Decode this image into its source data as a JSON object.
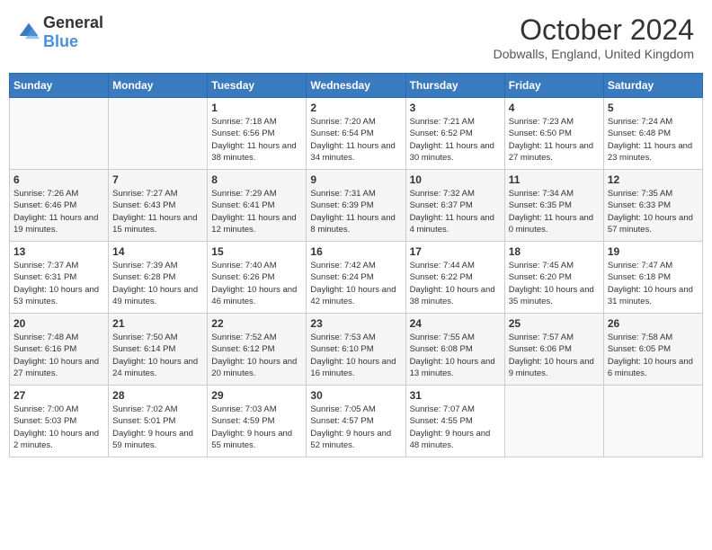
{
  "header": {
    "logo_general": "General",
    "logo_blue": "Blue",
    "month_title": "October 2024",
    "location": "Dobwalls, England, United Kingdom"
  },
  "days_of_week": [
    "Sunday",
    "Monday",
    "Tuesday",
    "Wednesday",
    "Thursday",
    "Friday",
    "Saturday"
  ],
  "weeks": [
    [
      {
        "day": "",
        "info": ""
      },
      {
        "day": "",
        "info": ""
      },
      {
        "day": "1",
        "info": "Sunrise: 7:18 AM\nSunset: 6:56 PM\nDaylight: 11 hours and 38 minutes."
      },
      {
        "day": "2",
        "info": "Sunrise: 7:20 AM\nSunset: 6:54 PM\nDaylight: 11 hours and 34 minutes."
      },
      {
        "day": "3",
        "info": "Sunrise: 7:21 AM\nSunset: 6:52 PM\nDaylight: 11 hours and 30 minutes."
      },
      {
        "day": "4",
        "info": "Sunrise: 7:23 AM\nSunset: 6:50 PM\nDaylight: 11 hours and 27 minutes."
      },
      {
        "day": "5",
        "info": "Sunrise: 7:24 AM\nSunset: 6:48 PM\nDaylight: 11 hours and 23 minutes."
      }
    ],
    [
      {
        "day": "6",
        "info": "Sunrise: 7:26 AM\nSunset: 6:46 PM\nDaylight: 11 hours and 19 minutes."
      },
      {
        "day": "7",
        "info": "Sunrise: 7:27 AM\nSunset: 6:43 PM\nDaylight: 11 hours and 15 minutes."
      },
      {
        "day": "8",
        "info": "Sunrise: 7:29 AM\nSunset: 6:41 PM\nDaylight: 11 hours and 12 minutes."
      },
      {
        "day": "9",
        "info": "Sunrise: 7:31 AM\nSunset: 6:39 PM\nDaylight: 11 hours and 8 minutes."
      },
      {
        "day": "10",
        "info": "Sunrise: 7:32 AM\nSunset: 6:37 PM\nDaylight: 11 hours and 4 minutes."
      },
      {
        "day": "11",
        "info": "Sunrise: 7:34 AM\nSunset: 6:35 PM\nDaylight: 11 hours and 0 minutes."
      },
      {
        "day": "12",
        "info": "Sunrise: 7:35 AM\nSunset: 6:33 PM\nDaylight: 10 hours and 57 minutes."
      }
    ],
    [
      {
        "day": "13",
        "info": "Sunrise: 7:37 AM\nSunset: 6:31 PM\nDaylight: 10 hours and 53 minutes."
      },
      {
        "day": "14",
        "info": "Sunrise: 7:39 AM\nSunset: 6:28 PM\nDaylight: 10 hours and 49 minutes."
      },
      {
        "day": "15",
        "info": "Sunrise: 7:40 AM\nSunset: 6:26 PM\nDaylight: 10 hours and 46 minutes."
      },
      {
        "day": "16",
        "info": "Sunrise: 7:42 AM\nSunset: 6:24 PM\nDaylight: 10 hours and 42 minutes."
      },
      {
        "day": "17",
        "info": "Sunrise: 7:44 AM\nSunset: 6:22 PM\nDaylight: 10 hours and 38 minutes."
      },
      {
        "day": "18",
        "info": "Sunrise: 7:45 AM\nSunset: 6:20 PM\nDaylight: 10 hours and 35 minutes."
      },
      {
        "day": "19",
        "info": "Sunrise: 7:47 AM\nSunset: 6:18 PM\nDaylight: 10 hours and 31 minutes."
      }
    ],
    [
      {
        "day": "20",
        "info": "Sunrise: 7:48 AM\nSunset: 6:16 PM\nDaylight: 10 hours and 27 minutes."
      },
      {
        "day": "21",
        "info": "Sunrise: 7:50 AM\nSunset: 6:14 PM\nDaylight: 10 hours and 24 minutes."
      },
      {
        "day": "22",
        "info": "Sunrise: 7:52 AM\nSunset: 6:12 PM\nDaylight: 10 hours and 20 minutes."
      },
      {
        "day": "23",
        "info": "Sunrise: 7:53 AM\nSunset: 6:10 PM\nDaylight: 10 hours and 16 minutes."
      },
      {
        "day": "24",
        "info": "Sunrise: 7:55 AM\nSunset: 6:08 PM\nDaylight: 10 hours and 13 minutes."
      },
      {
        "day": "25",
        "info": "Sunrise: 7:57 AM\nSunset: 6:06 PM\nDaylight: 10 hours and 9 minutes."
      },
      {
        "day": "26",
        "info": "Sunrise: 7:58 AM\nSunset: 6:05 PM\nDaylight: 10 hours and 6 minutes."
      }
    ],
    [
      {
        "day": "27",
        "info": "Sunrise: 7:00 AM\nSunset: 5:03 PM\nDaylight: 10 hours and 2 minutes."
      },
      {
        "day": "28",
        "info": "Sunrise: 7:02 AM\nSunset: 5:01 PM\nDaylight: 9 hours and 59 minutes."
      },
      {
        "day": "29",
        "info": "Sunrise: 7:03 AM\nSunset: 4:59 PM\nDaylight: 9 hours and 55 minutes."
      },
      {
        "day": "30",
        "info": "Sunrise: 7:05 AM\nSunset: 4:57 PM\nDaylight: 9 hours and 52 minutes."
      },
      {
        "day": "31",
        "info": "Sunrise: 7:07 AM\nSunset: 4:55 PM\nDaylight: 9 hours and 48 minutes."
      },
      {
        "day": "",
        "info": ""
      },
      {
        "day": "",
        "info": ""
      }
    ]
  ]
}
